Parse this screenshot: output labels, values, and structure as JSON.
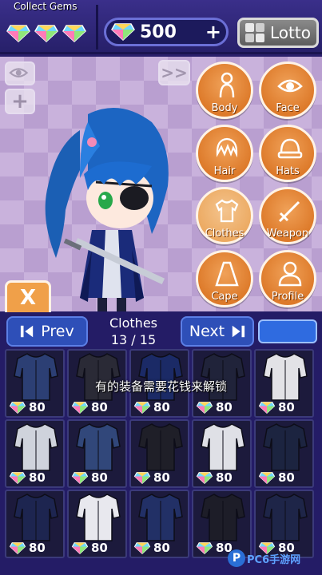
{
  "topbar": {
    "collect_label": "Collect Gems",
    "gem_count": "500",
    "plus_label": "+",
    "lotto_label": "Lotto"
  },
  "stage": {
    "add_label": "+",
    "collapse_label": ">>",
    "close_label": "X"
  },
  "categories": [
    {
      "label": "Body",
      "icon": "body-icon"
    },
    {
      "label": "Face",
      "icon": "eye-icon"
    },
    {
      "label": "Hair",
      "icon": "hair-icon"
    },
    {
      "label": "Hats",
      "icon": "hat-icon"
    },
    {
      "label": "Clothes",
      "icon": "shirt-icon"
    },
    {
      "label": "Weapon",
      "icon": "sword-icon"
    },
    {
      "label": "Cape",
      "icon": "cape-icon"
    },
    {
      "label": "Profile",
      "icon": "profile-icon"
    }
  ],
  "panel": {
    "prev_label": "Prev",
    "next_label": "Next",
    "title": "Clothes",
    "page": "13 / 15",
    "items": [
      {
        "price": "80",
        "color": "#2c3f74"
      },
      {
        "price": "80",
        "color": "#2a2a36"
      },
      {
        "price": "80",
        "color": "#1b2a66"
      },
      {
        "price": "80",
        "color": "#20233a"
      },
      {
        "price": "80",
        "color": "#e2e2e6"
      },
      {
        "price": "80",
        "color": "#cfd3dc"
      },
      {
        "price": "80",
        "color": "#31477a"
      },
      {
        "price": "80",
        "color": "#1f1f28"
      },
      {
        "price": "80",
        "color": "#dfe0e6"
      },
      {
        "price": "80",
        "color": "#1c2440"
      },
      {
        "price": "80",
        "color": "#1d2550"
      },
      {
        "price": "80",
        "color": "#e8e8ee"
      },
      {
        "price": "80",
        "color": "#223066"
      },
      {
        "price": "80",
        "color": "#1d1d28"
      },
      {
        "price": "80",
        "color": "#1e2548"
      }
    ]
  },
  "overlay_text": "有的装备需要花钱来解锁",
  "watermark": "PC6手游网",
  "colors": {
    "accent": "#e58a35",
    "panel": "#241c66",
    "button": "#2e4fb8"
  }
}
